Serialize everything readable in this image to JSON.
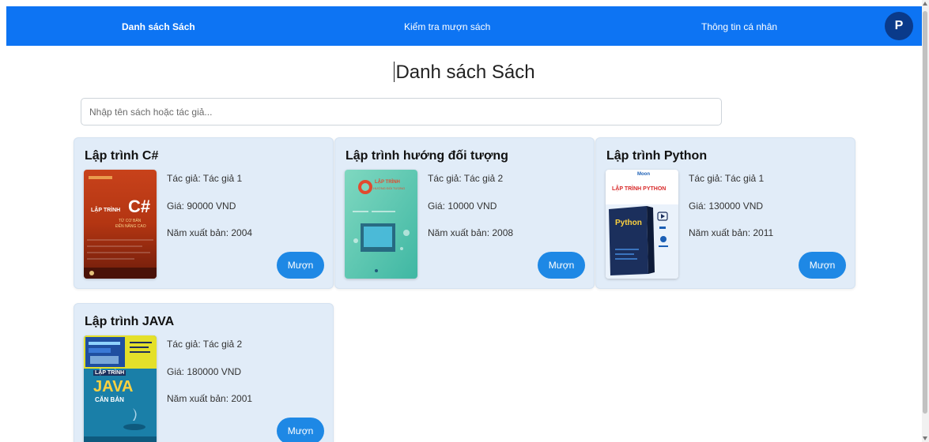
{
  "nav": {
    "items": [
      {
        "label": "Danh sách Sách",
        "active": true
      },
      {
        "label": "Kiểm tra mượn sách",
        "active": false
      },
      {
        "label": "Thông tin cá nhân",
        "active": false
      }
    ],
    "avatar_letter": "P",
    "bar_color": "#0d74f3"
  },
  "page": {
    "title": "Danh sách Sách"
  },
  "search": {
    "placeholder": "Nhập tên sách hoặc tác giả...",
    "value": ""
  },
  "books": [
    {
      "title": "Lập trình C#",
      "author": "Tác giả: Tác giả 1",
      "price": "Giá: 90000 VND",
      "year": "Năm xuất bản: 2004",
      "borrow_label": "Mượn",
      "cover_texts": [
        "LẬP TRÌNH",
        "C#",
        "TỪ CƠ BẢN",
        "ĐẾN NÂNG CAO"
      ]
    },
    {
      "title": "Lập trình hướng đối tượng",
      "author": "Tác giả: Tác giả 2",
      "price": "Giá: 10000 VND",
      "year": "Năm xuất bản: 2008",
      "borrow_label": "Mượn",
      "cover_texts": [
        "LẬP TRÌNH",
        "HƯỚNG ĐỐI TƯỢNG"
      ]
    },
    {
      "title": "Lập trình Python",
      "author": "Tác giả: Tác giả 1",
      "price": "Giá: 130000 VND",
      "year": "Năm xuất bản: 2011",
      "borrow_label": "Mượn",
      "cover_texts": [
        "Moon",
        "LẬP TRÌNH PYTHON",
        "Python"
      ]
    },
    {
      "title": "Lập trình JAVA",
      "author": "Tác giả: Tác giả 2",
      "price": "Giá: 180000 VND",
      "year": "Năm xuất bản: 2001",
      "borrow_label": "Mượn",
      "cover_texts": [
        "LẬP TRÌNH",
        "JAVA",
        "CĂN BẢN"
      ]
    }
  ]
}
